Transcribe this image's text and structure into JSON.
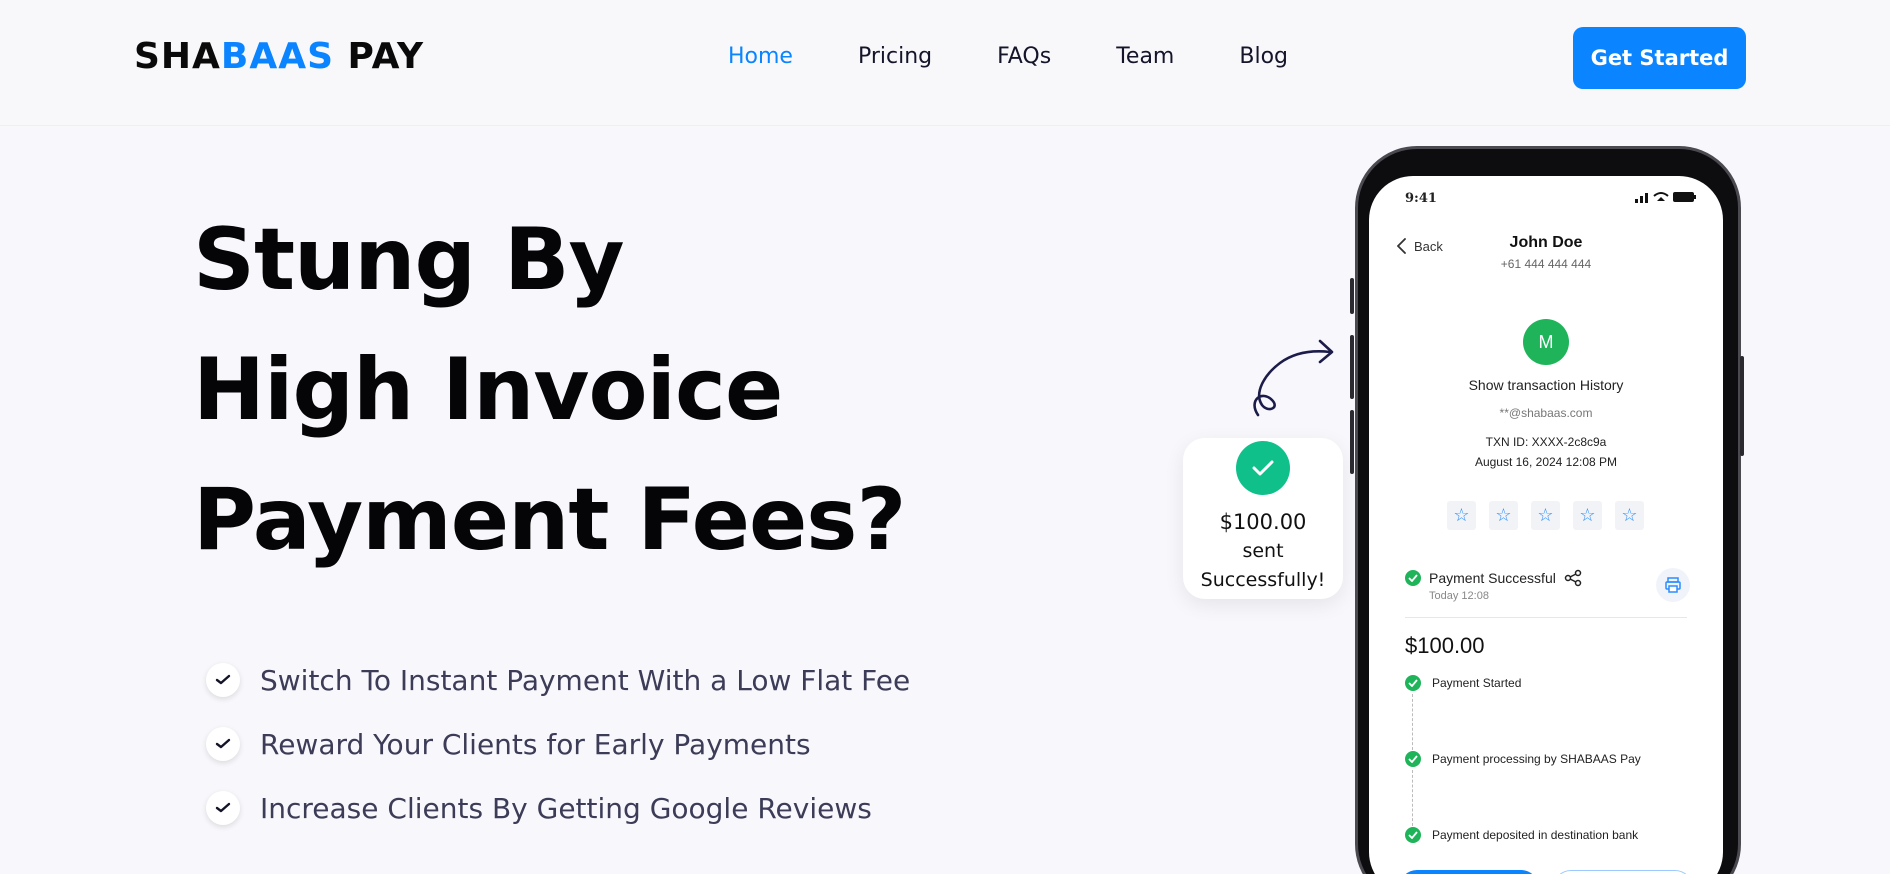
{
  "header": {
    "logo_left": "SHA",
    "logo_mid": "BAAS",
    "logo_right": " PAY",
    "nav": [
      {
        "label": "Home",
        "active": true
      },
      {
        "label": "Pricing"
      },
      {
        "label": "FAQs"
      },
      {
        "label": "Team"
      },
      {
        "label": "Blog"
      }
    ],
    "cta_label": "Get Started"
  },
  "hero": {
    "headline": [
      "Stung By",
      "High Invoice",
      "Payment Fees?"
    ],
    "features": [
      "Switch To Instant Payment With a Low Flat Fee",
      "Reward Your Clients for Early Payments",
      "Increase Clients By Getting Google Reviews"
    ]
  },
  "toast": {
    "amount": "$100.00",
    "line2": "sent",
    "line3": "Successfully!"
  },
  "phone": {
    "status_time": "9:41",
    "back_label": "Back",
    "contact_name": "John Doe",
    "contact_phone": "+61 444 444 444",
    "avatar_letter": "M",
    "history_label": "Show transaction History",
    "email": "**@shabaas.com",
    "txn_id": "TXN ID: XXXX-2c8c9a",
    "txn_date": "August 16, 2024 12:08 PM",
    "rating_stars": 5,
    "payment_status": "Payment Successful",
    "payment_time": "Today 12:08",
    "amount": "$100.00",
    "steps": [
      "Payment Started",
      "Payment processing by SHABAAS Pay",
      "Payment deposited in destination bank"
    ]
  },
  "colors": {
    "accent": "#0a84ff",
    "success": "#1fb45a",
    "toast_check": "#10c08a",
    "background": "#f8f8fc"
  }
}
